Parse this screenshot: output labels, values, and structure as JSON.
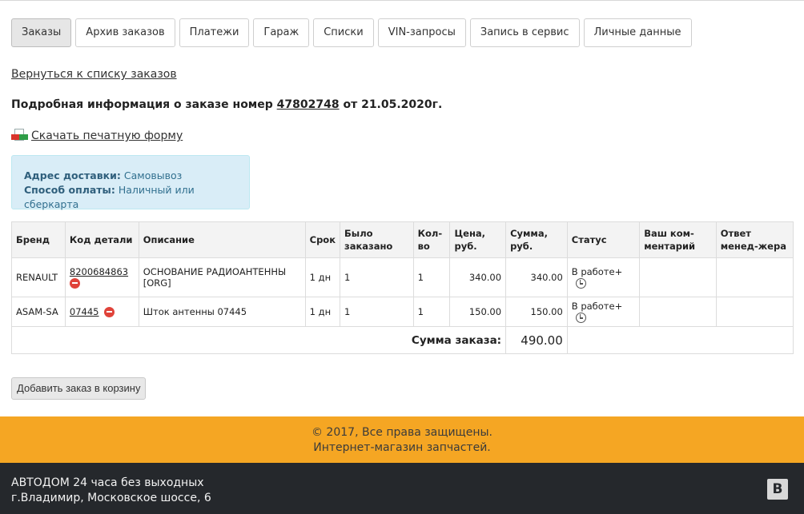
{
  "tabs": [
    {
      "label": "Заказы",
      "active": true
    },
    {
      "label": "Архив заказов"
    },
    {
      "label": "Платежи"
    },
    {
      "label": "Гараж"
    },
    {
      "label": "Списки"
    },
    {
      "label": "VIN-запросы"
    },
    {
      "label": "Запись в сервис"
    },
    {
      "label": "Личные данные"
    }
  ],
  "back_link": "Вернуться к списку заказов",
  "heading": {
    "prefix": "Подробная информация о заказе номер",
    "number": "47802748",
    "suffix": "от 21.05.2020г."
  },
  "download_link": "Скачать печатную форму",
  "info": {
    "delivery_label": "Адрес доставки:",
    "delivery_value": "Самовывоз",
    "payment_label": "Способ оплаты:",
    "payment_value": "Наличный или сберкарта"
  },
  "table": {
    "headers": {
      "brand": "Бренд",
      "code": "Код детали",
      "description": "Описание",
      "term": "Срок",
      "ordered": "Было заказано",
      "qty": "Кол-во",
      "price": "Цена, руб.",
      "sum": "Сумма, руб.",
      "status": "Статус",
      "comment": "Ваш ком-ментарий",
      "reply": "Ответ менед-жера"
    },
    "rows": [
      {
        "brand": "RENAULT",
        "code": "8200684863",
        "description": "ОСНОВАНИЕ РАДИОАНТЕННЫ [ORG]",
        "term": "1 дн",
        "ordered": "1",
        "qty": "1",
        "price": "340.00",
        "sum": "340.00",
        "status": "В работе+",
        "comment": "",
        "reply": ""
      },
      {
        "brand": "ASAM-SA",
        "code": "07445",
        "description": "Шток антенны 07445",
        "term": "1 дн",
        "ordered": "1",
        "qty": "1",
        "price": "150.00",
        "sum": "150.00",
        "status": "В работе+",
        "comment": "",
        "reply": ""
      }
    ],
    "total_label": "Сумма заказа:",
    "total_value": "490.00"
  },
  "add_to_cart": "Добавить заказ в корзину",
  "footer": {
    "copyright": "© 2017, Все права защищены.",
    "tagline": "Интернет-магазин запчастей.",
    "company": "АВТОДОМ 24 часа без выходных",
    "address": "г.Владимир, Московское шоссе, 6",
    "social_glyph": "B"
  },
  "colors": {
    "footer_accent": "#f5a623",
    "footer_dark": "#25282c",
    "info_bg": "#d9edf7",
    "remove_red": "#e0433a"
  }
}
